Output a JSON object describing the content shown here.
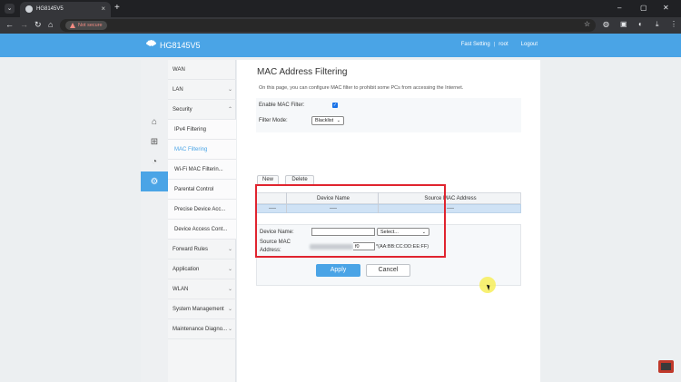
{
  "browser": {
    "tab_title": "HG8145V5",
    "security_badge": "Not secure",
    "url": "",
    "icons": [
      "tab-search-icon",
      "close-icon",
      "new-tab-icon",
      "back-icon",
      "forward-icon",
      "reload-icon",
      "home-icon",
      "star-icon",
      "extensions-icon",
      "profile-icon",
      "menu-icon",
      "minimize-icon",
      "maximize-icon",
      "window-close-icon"
    ]
  },
  "header": {
    "logo_text": "HG8145V5",
    "fast_setting": "Fast Setting",
    "separator": "|",
    "user": "root",
    "logout": "Logout",
    "accent_color": "#4aa4e6"
  },
  "rail": [
    "home-icon",
    "plus-box-icon",
    "gauge-icon",
    "gear-icon"
  ],
  "menu": {
    "items": [
      {
        "label": "WAN",
        "chevron": ""
      },
      {
        "label": "LAN",
        "chevron": "⌄"
      },
      {
        "label": "Security",
        "chevron": "⌃"
      },
      {
        "label": "IPv4 Filtering",
        "chevron": ""
      },
      {
        "label": "MAC Filtering",
        "chevron": ""
      },
      {
        "label": "Wi-Fi MAC Filterin...",
        "chevron": ""
      },
      {
        "label": "Parental Control",
        "chevron": ""
      },
      {
        "label": "Precise Device Acc...",
        "chevron": ""
      },
      {
        "label": "Device Access Cont...",
        "chevron": ""
      },
      {
        "label": "Forward Rules",
        "chevron": "⌄"
      },
      {
        "label": "Application",
        "chevron": "⌄"
      },
      {
        "label": "WLAN",
        "chevron": "⌄"
      },
      {
        "label": "System Management",
        "chevron": "⌄"
      },
      {
        "label": "Maintenance Diagno...",
        "chevron": "⌄"
      }
    ]
  },
  "page": {
    "title": "MAC Address Filtering",
    "description": "On this page, you can configure MAC filter to prohibit some PCs from accessing the Internet.",
    "enable_label": "Enable MAC Filter:",
    "enable_checked": "✓",
    "mode_label": "Filter Mode:",
    "mode_value": "Blacklist",
    "new_label": "New",
    "delete_label": "Delete",
    "table": {
      "headers": [
        "",
        "Device Name",
        "Source MAC Address"
      ],
      "rows": [
        [
          "----",
          "----",
          "----"
        ]
      ]
    },
    "form": {
      "device_name_label": "Device Name:",
      "device_name_value": "",
      "device_select": "Select...",
      "mac_label_1": "Source MAC",
      "mac_label_2": "Address:",
      "mac_value_tail": "f0",
      "mac_hint": "*(AA:BB:CC:DD:EE:FF)",
      "apply_label": "Apply",
      "cancel_label": "Cancel"
    }
  }
}
